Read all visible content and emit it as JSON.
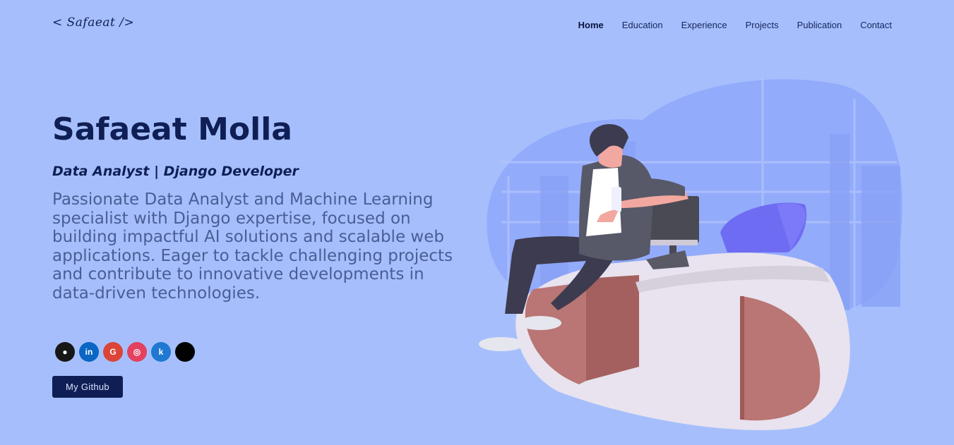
{
  "logo": {
    "text": "< Safaeat />"
  },
  "nav": [
    {
      "label": "Home",
      "active": true
    },
    {
      "label": "Education"
    },
    {
      "label": "Experience"
    },
    {
      "label": "Projects"
    },
    {
      "label": "Publication"
    },
    {
      "label": "Contact"
    }
  ],
  "hero": {
    "name": "Safaeat Molla",
    "role": "Data Analyst | Django Developer",
    "description": "Passionate Data Analyst and Machine Learning specialist with Django expertise, focused on building impactful AI solutions and scalable web applications. Eager to tackle challenging projects and contribute to innovative developments in data-driven technologies.",
    "cta_label": "My Github"
  },
  "socials": [
    {
      "icon": "github-icon",
      "glyph": "●",
      "color": "#181717"
    },
    {
      "icon": "linkedin-icon",
      "glyph": "in",
      "color": "#0a66c2"
    },
    {
      "icon": "google-icon",
      "glyph": "G",
      "color": "#db4437"
    },
    {
      "icon": "instagram-icon",
      "glyph": "◎",
      "color": "#e4405f"
    },
    {
      "icon": "kaggle-icon",
      "glyph": "k",
      "color": "#1f78d1"
    },
    {
      "icon": "x-icon",
      "glyph": "",
      "color": "#000000"
    }
  ],
  "colors": {
    "background": "#a6bffc",
    "primary": "#0f1f55",
    "text_muted": "#4a5d96"
  }
}
